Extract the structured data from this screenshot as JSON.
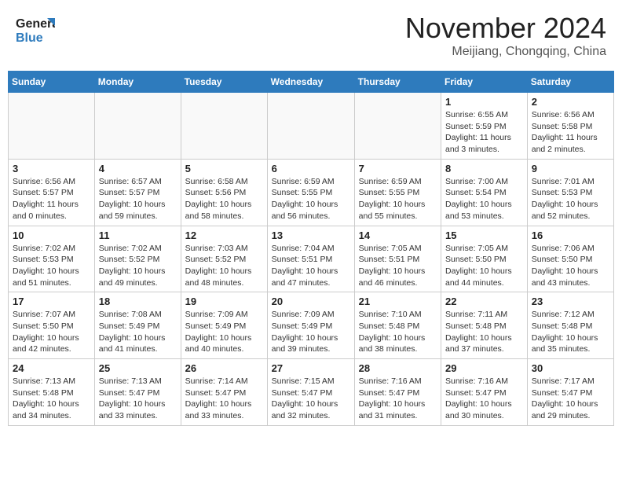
{
  "header": {
    "logo_general": "General",
    "logo_blue": "Blue",
    "month_title": "November 2024",
    "location": "Meijiang, Chongqing, China"
  },
  "weekdays": [
    "Sunday",
    "Monday",
    "Tuesday",
    "Wednesday",
    "Thursday",
    "Friday",
    "Saturday"
  ],
  "weeks": [
    [
      {
        "day": "",
        "info": ""
      },
      {
        "day": "",
        "info": ""
      },
      {
        "day": "",
        "info": ""
      },
      {
        "day": "",
        "info": ""
      },
      {
        "day": "",
        "info": ""
      },
      {
        "day": "1",
        "info": "Sunrise: 6:55 AM\nSunset: 5:59 PM\nDaylight: 11 hours\nand 3 minutes."
      },
      {
        "day": "2",
        "info": "Sunrise: 6:56 AM\nSunset: 5:58 PM\nDaylight: 11 hours\nand 2 minutes."
      }
    ],
    [
      {
        "day": "3",
        "info": "Sunrise: 6:56 AM\nSunset: 5:57 PM\nDaylight: 11 hours\nand 0 minutes."
      },
      {
        "day": "4",
        "info": "Sunrise: 6:57 AM\nSunset: 5:57 PM\nDaylight: 10 hours\nand 59 minutes."
      },
      {
        "day": "5",
        "info": "Sunrise: 6:58 AM\nSunset: 5:56 PM\nDaylight: 10 hours\nand 58 minutes."
      },
      {
        "day": "6",
        "info": "Sunrise: 6:59 AM\nSunset: 5:55 PM\nDaylight: 10 hours\nand 56 minutes."
      },
      {
        "day": "7",
        "info": "Sunrise: 6:59 AM\nSunset: 5:55 PM\nDaylight: 10 hours\nand 55 minutes."
      },
      {
        "day": "8",
        "info": "Sunrise: 7:00 AM\nSunset: 5:54 PM\nDaylight: 10 hours\nand 53 minutes."
      },
      {
        "day": "9",
        "info": "Sunrise: 7:01 AM\nSunset: 5:53 PM\nDaylight: 10 hours\nand 52 minutes."
      }
    ],
    [
      {
        "day": "10",
        "info": "Sunrise: 7:02 AM\nSunset: 5:53 PM\nDaylight: 10 hours\nand 51 minutes."
      },
      {
        "day": "11",
        "info": "Sunrise: 7:02 AM\nSunset: 5:52 PM\nDaylight: 10 hours\nand 49 minutes."
      },
      {
        "day": "12",
        "info": "Sunrise: 7:03 AM\nSunset: 5:52 PM\nDaylight: 10 hours\nand 48 minutes."
      },
      {
        "day": "13",
        "info": "Sunrise: 7:04 AM\nSunset: 5:51 PM\nDaylight: 10 hours\nand 47 minutes."
      },
      {
        "day": "14",
        "info": "Sunrise: 7:05 AM\nSunset: 5:51 PM\nDaylight: 10 hours\nand 46 minutes."
      },
      {
        "day": "15",
        "info": "Sunrise: 7:05 AM\nSunset: 5:50 PM\nDaylight: 10 hours\nand 44 minutes."
      },
      {
        "day": "16",
        "info": "Sunrise: 7:06 AM\nSunset: 5:50 PM\nDaylight: 10 hours\nand 43 minutes."
      }
    ],
    [
      {
        "day": "17",
        "info": "Sunrise: 7:07 AM\nSunset: 5:50 PM\nDaylight: 10 hours\nand 42 minutes."
      },
      {
        "day": "18",
        "info": "Sunrise: 7:08 AM\nSunset: 5:49 PM\nDaylight: 10 hours\nand 41 minutes."
      },
      {
        "day": "19",
        "info": "Sunrise: 7:09 AM\nSunset: 5:49 PM\nDaylight: 10 hours\nand 40 minutes."
      },
      {
        "day": "20",
        "info": "Sunrise: 7:09 AM\nSunset: 5:49 PM\nDaylight: 10 hours\nand 39 minutes."
      },
      {
        "day": "21",
        "info": "Sunrise: 7:10 AM\nSunset: 5:48 PM\nDaylight: 10 hours\nand 38 minutes."
      },
      {
        "day": "22",
        "info": "Sunrise: 7:11 AM\nSunset: 5:48 PM\nDaylight: 10 hours\nand 37 minutes."
      },
      {
        "day": "23",
        "info": "Sunrise: 7:12 AM\nSunset: 5:48 PM\nDaylight: 10 hours\nand 35 minutes."
      }
    ],
    [
      {
        "day": "24",
        "info": "Sunrise: 7:13 AM\nSunset: 5:48 PM\nDaylight: 10 hours\nand 34 minutes."
      },
      {
        "day": "25",
        "info": "Sunrise: 7:13 AM\nSunset: 5:47 PM\nDaylight: 10 hours\nand 33 minutes."
      },
      {
        "day": "26",
        "info": "Sunrise: 7:14 AM\nSunset: 5:47 PM\nDaylight: 10 hours\nand 33 minutes."
      },
      {
        "day": "27",
        "info": "Sunrise: 7:15 AM\nSunset: 5:47 PM\nDaylight: 10 hours\nand 32 minutes."
      },
      {
        "day": "28",
        "info": "Sunrise: 7:16 AM\nSunset: 5:47 PM\nDaylight: 10 hours\nand 31 minutes."
      },
      {
        "day": "29",
        "info": "Sunrise: 7:16 AM\nSunset: 5:47 PM\nDaylight: 10 hours\nand 30 minutes."
      },
      {
        "day": "30",
        "info": "Sunrise: 7:17 AM\nSunset: 5:47 PM\nDaylight: 10 hours\nand 29 minutes."
      }
    ]
  ]
}
